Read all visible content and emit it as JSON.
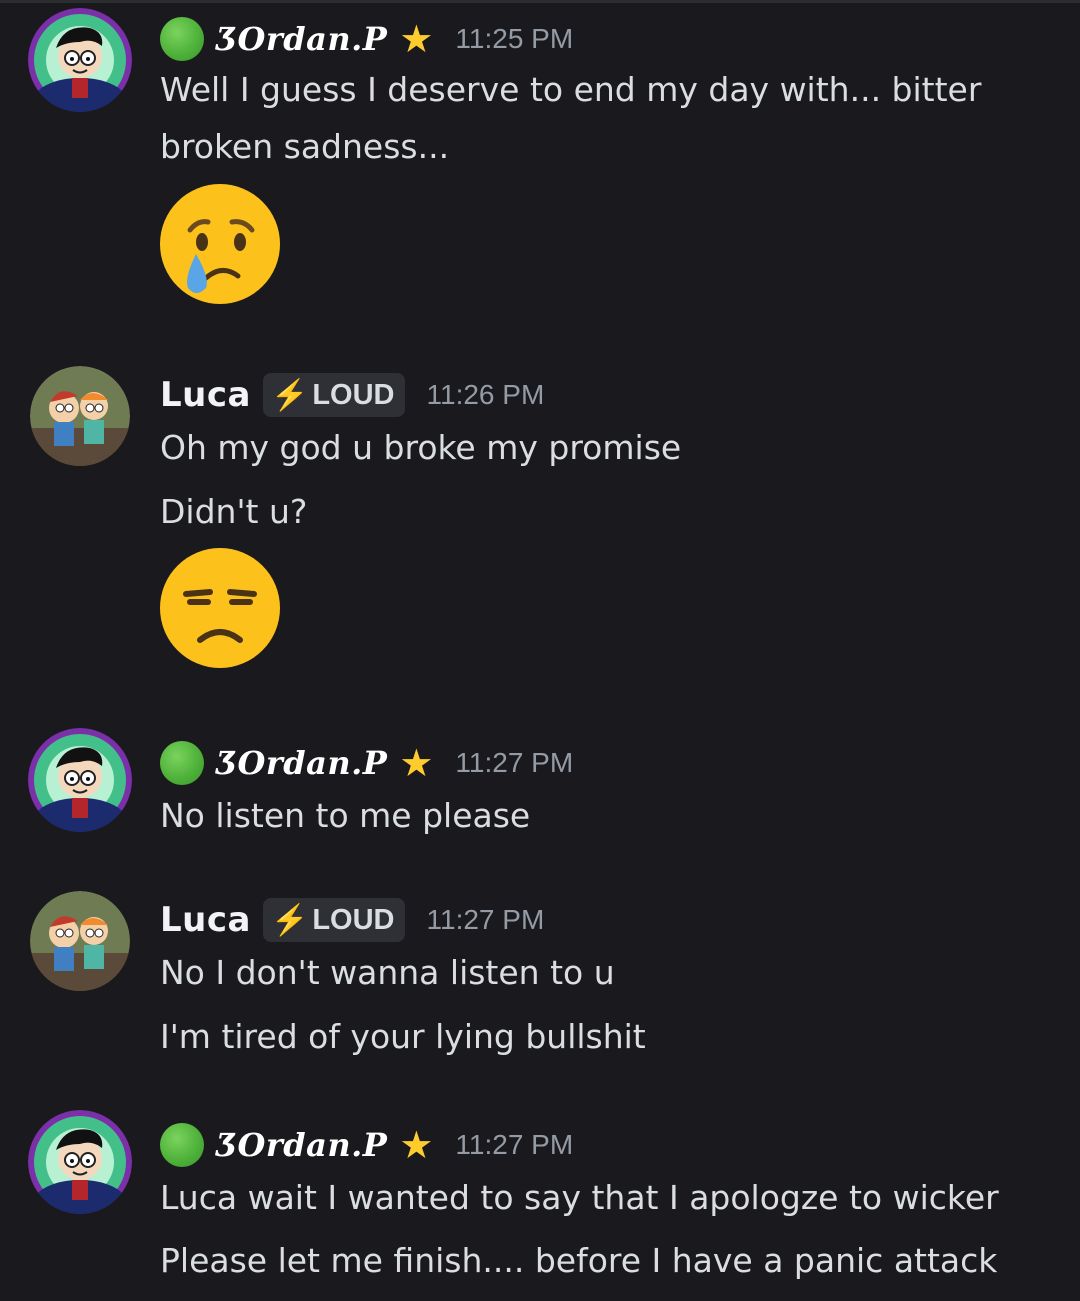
{
  "messages": [
    {
      "author": "ƷOrdan.P",
      "author_badge": "star",
      "timestamp": "11:25 PM",
      "lines": [
        "Well I guess I deserve to end my day with... bitter",
        "broken sadness..."
      ],
      "emoji": "crying-face"
    },
    {
      "author": "Luca",
      "tag": "LOUD",
      "timestamp": "11:26 PM",
      "lines": [
        "Oh my god u broke my promise",
        "Didn't u?"
      ],
      "emoji": "unamused-face"
    },
    {
      "author": "ƷOrdan.P",
      "author_badge": "star",
      "timestamp": "11:27 PM",
      "lines": [
        "No listen to me please"
      ]
    },
    {
      "author": "Luca",
      "tag": "LOUD",
      "timestamp": "11:27 PM",
      "lines": [
        "No I don't wanna listen to u",
        "I'm tired of your lying bullshit"
      ]
    },
    {
      "author": "ƷOrdan.P",
      "author_badge": "star",
      "timestamp": "11:27 PM",
      "lines": [
        "Luca wait I wanted to say that I apologze to wicker",
        "Please let me finish.... before I have a panic attack"
      ]
    }
  ],
  "colors": {
    "background": "#1a1a1e",
    "text": "#dbdee1",
    "timestamp": "#949ba4",
    "status_online": "#4fb23a",
    "star": "#ffcc2e",
    "tag_bg": "#2e3035",
    "bolt": "#f0b232"
  }
}
